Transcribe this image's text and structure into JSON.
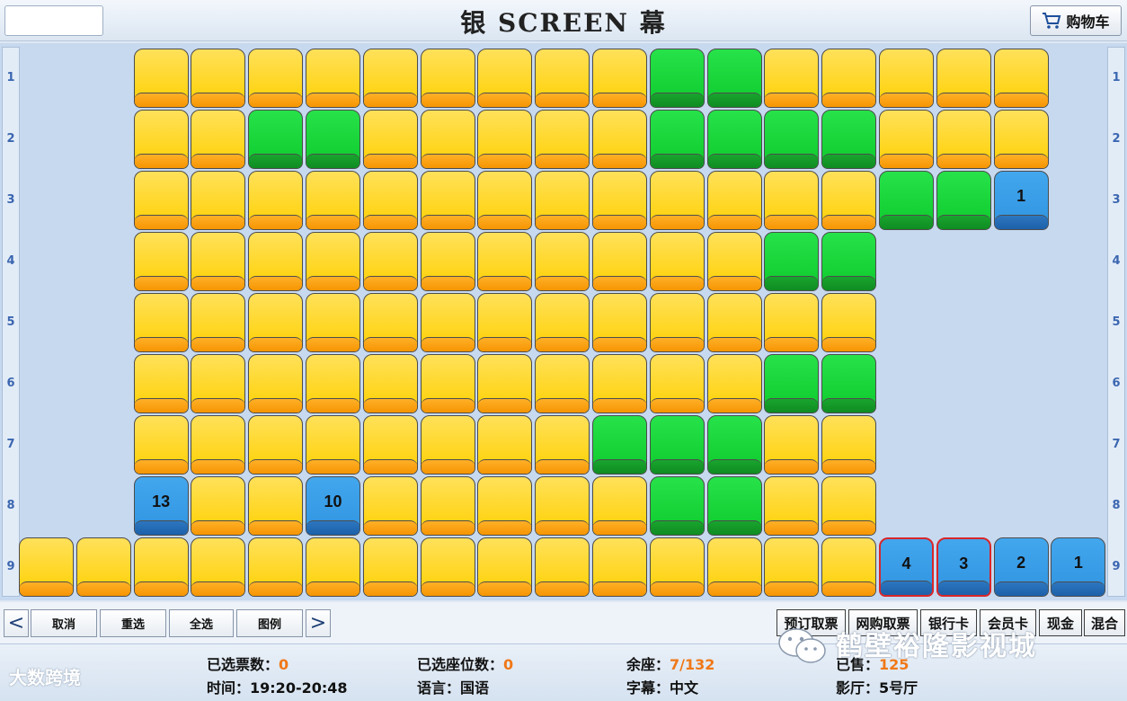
{
  "header": {
    "title": "银 SCREEN 幕",
    "cart_label": "购物车"
  },
  "rows": [
    {
      "label": "1",
      "seats": [
        {
          "col": 2,
          "s": "a"
        },
        {
          "col": 3,
          "s": "a"
        },
        {
          "col": 4,
          "s": "a"
        },
        {
          "col": 5,
          "s": "a"
        },
        {
          "col": 6,
          "s": "a"
        },
        {
          "col": 7,
          "s": "a"
        },
        {
          "col": 8,
          "s": "a"
        },
        {
          "col": 9,
          "s": "a"
        },
        {
          "col": 10,
          "s": "a"
        },
        {
          "col": 11,
          "s": "g"
        },
        {
          "col": 12,
          "s": "g"
        },
        {
          "col": 13,
          "s": "a"
        },
        {
          "col": 14,
          "s": "a"
        },
        {
          "col": 15,
          "s": "a"
        },
        {
          "col": 16,
          "s": "a"
        },
        {
          "col": 17,
          "s": "a"
        }
      ]
    },
    {
      "label": "2",
      "seats": [
        {
          "col": 2,
          "s": "a"
        },
        {
          "col": 3,
          "s": "a"
        },
        {
          "col": 4,
          "s": "g"
        },
        {
          "col": 5,
          "s": "g"
        },
        {
          "col": 6,
          "s": "a"
        },
        {
          "col": 7,
          "s": "a"
        },
        {
          "col": 8,
          "s": "a"
        },
        {
          "col": 9,
          "s": "a"
        },
        {
          "col": 10,
          "s": "a"
        },
        {
          "col": 11,
          "s": "g"
        },
        {
          "col": 12,
          "s": "g"
        },
        {
          "col": 13,
          "s": "g"
        },
        {
          "col": 14,
          "s": "g"
        },
        {
          "col": 15,
          "s": "a"
        },
        {
          "col": 16,
          "s": "a"
        },
        {
          "col": 17,
          "s": "a"
        }
      ]
    },
    {
      "label": "3",
      "seats": [
        {
          "col": 2,
          "s": "a"
        },
        {
          "col": 3,
          "s": "a"
        },
        {
          "col": 4,
          "s": "a"
        },
        {
          "col": 5,
          "s": "a"
        },
        {
          "col": 6,
          "s": "a"
        },
        {
          "col": 7,
          "s": "a"
        },
        {
          "col": 8,
          "s": "a"
        },
        {
          "col": 9,
          "s": "a"
        },
        {
          "col": 10,
          "s": "a"
        },
        {
          "col": 11,
          "s": "a"
        },
        {
          "col": 12,
          "s": "a"
        },
        {
          "col": 13,
          "s": "a"
        },
        {
          "col": 14,
          "s": "a"
        },
        {
          "col": 15,
          "s": "g"
        },
        {
          "col": 16,
          "s": "g"
        },
        {
          "col": 17,
          "s": "b",
          "n": "1"
        }
      ]
    },
    {
      "label": "4",
      "seats": [
        {
          "col": 2,
          "s": "a"
        },
        {
          "col": 3,
          "s": "a"
        },
        {
          "col": 4,
          "s": "a"
        },
        {
          "col": 5,
          "s": "a"
        },
        {
          "col": 6,
          "s": "a"
        },
        {
          "col": 7,
          "s": "a"
        },
        {
          "col": 8,
          "s": "a"
        },
        {
          "col": 9,
          "s": "a"
        },
        {
          "col": 10,
          "s": "a"
        },
        {
          "col": 11,
          "s": "a"
        },
        {
          "col": 12,
          "s": "a"
        },
        {
          "col": 13,
          "s": "g"
        },
        {
          "col": 14,
          "s": "g"
        }
      ]
    },
    {
      "label": "5",
      "seats": [
        {
          "col": 2,
          "s": "a"
        },
        {
          "col": 3,
          "s": "a"
        },
        {
          "col": 4,
          "s": "a"
        },
        {
          "col": 5,
          "s": "a"
        },
        {
          "col": 6,
          "s": "a"
        },
        {
          "col": 7,
          "s": "a"
        },
        {
          "col": 8,
          "s": "a"
        },
        {
          "col": 9,
          "s": "a"
        },
        {
          "col": 10,
          "s": "a"
        },
        {
          "col": 11,
          "s": "a"
        },
        {
          "col": 12,
          "s": "a"
        },
        {
          "col": 13,
          "s": "a"
        },
        {
          "col": 14,
          "s": "a"
        }
      ]
    },
    {
      "label": "6",
      "seats": [
        {
          "col": 2,
          "s": "a"
        },
        {
          "col": 3,
          "s": "a"
        },
        {
          "col": 4,
          "s": "a"
        },
        {
          "col": 5,
          "s": "a"
        },
        {
          "col": 6,
          "s": "a"
        },
        {
          "col": 7,
          "s": "a"
        },
        {
          "col": 8,
          "s": "a"
        },
        {
          "col": 9,
          "s": "a"
        },
        {
          "col": 10,
          "s": "a"
        },
        {
          "col": 11,
          "s": "a"
        },
        {
          "col": 12,
          "s": "a"
        },
        {
          "col": 13,
          "s": "g"
        },
        {
          "col": 14,
          "s": "g"
        }
      ]
    },
    {
      "label": "7",
      "seats": [
        {
          "col": 2,
          "s": "a"
        },
        {
          "col": 3,
          "s": "a"
        },
        {
          "col": 4,
          "s": "a"
        },
        {
          "col": 5,
          "s": "a"
        },
        {
          "col": 6,
          "s": "a"
        },
        {
          "col": 7,
          "s": "a"
        },
        {
          "col": 8,
          "s": "a"
        },
        {
          "col": 9,
          "s": "a"
        },
        {
          "col": 10,
          "s": "g"
        },
        {
          "col": 11,
          "s": "g"
        },
        {
          "col": 12,
          "s": "g"
        },
        {
          "col": 13,
          "s": "a"
        },
        {
          "col": 14,
          "s": "a"
        }
      ]
    },
    {
      "label": "8",
      "seats": [
        {
          "col": 2,
          "s": "b",
          "n": "13"
        },
        {
          "col": 3,
          "s": "a"
        },
        {
          "col": 4,
          "s": "a"
        },
        {
          "col": 5,
          "s": "b",
          "n": "10"
        },
        {
          "col": 6,
          "s": "a"
        },
        {
          "col": 7,
          "s": "a"
        },
        {
          "col": 8,
          "s": "a"
        },
        {
          "col": 9,
          "s": "a"
        },
        {
          "col": 10,
          "s": "a"
        },
        {
          "col": 11,
          "s": "g"
        },
        {
          "col": 12,
          "s": "g"
        },
        {
          "col": 13,
          "s": "a"
        },
        {
          "col": 14,
          "s": "a"
        }
      ]
    },
    {
      "label": "9",
      "seats": [
        {
          "col": 0,
          "s": "a"
        },
        {
          "col": 1,
          "s": "a"
        },
        {
          "col": 2,
          "s": "a"
        },
        {
          "col": 3,
          "s": "a"
        },
        {
          "col": 4,
          "s": "a"
        },
        {
          "col": 5,
          "s": "a"
        },
        {
          "col": 6,
          "s": "a"
        },
        {
          "col": 7,
          "s": "a"
        },
        {
          "col": 8,
          "s": "a"
        },
        {
          "col": 9,
          "s": "a"
        },
        {
          "col": 10,
          "s": "a"
        },
        {
          "col": 11,
          "s": "a"
        },
        {
          "col": 12,
          "s": "a"
        },
        {
          "col": 13,
          "s": "a"
        },
        {
          "col": 14,
          "s": "a"
        },
        {
          "col": 15,
          "s": "b",
          "n": "4",
          "hl": true
        },
        {
          "col": 16,
          "s": "b",
          "n": "3",
          "hl": true
        },
        {
          "col": 17,
          "s": "b",
          "n": "2"
        },
        {
          "col": 18,
          "s": "b",
          "n": "1"
        }
      ]
    }
  ],
  "toolbar": {
    "prev": "<",
    "next": ">",
    "left_buttons": [
      "取消",
      "重选",
      "全选",
      "图例"
    ],
    "right_buttons": [
      "预订取票",
      "网购取票",
      "银行卡",
      "会员卡",
      "现金",
      "混合"
    ]
  },
  "info": {
    "selected_tickets_label": "已选票数：",
    "selected_tickets_value": "0",
    "selected_seats_label": "已选座位数：",
    "selected_seats_value": "0",
    "remaining_label": "余座：",
    "remaining_value": "7/132",
    "sold_label": "已售：",
    "sold_value": "125",
    "time_label": "时间：",
    "time_value": "19:20-20:48",
    "language_label": "语言：",
    "language_value": "国语",
    "subtitle_label": "字幕：",
    "subtitle_value": "中文",
    "hall_label": "影厅：",
    "hall_value": "5号厅"
  },
  "watermark": {
    "left": "大数跨境",
    "right": "鹤壁裕隆影视城"
  },
  "colors": {
    "available": "#ffd800",
    "sold": "#12d232",
    "selected": "#3a9de8",
    "highlight_border": "#d8262a",
    "value_accent": "#f07818"
  }
}
